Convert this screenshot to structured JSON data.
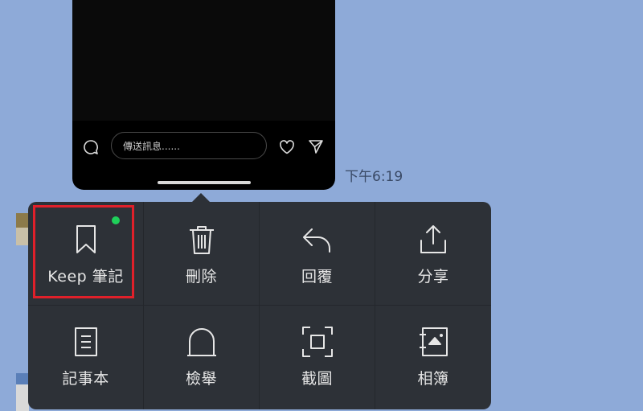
{
  "message_bar": {
    "input_placeholder": "傳送訊息......"
  },
  "timestamp": "下午6:19",
  "menu": {
    "items": [
      {
        "label": "Keep 筆記",
        "icon": "bookmark-icon"
      },
      {
        "label": "刪除",
        "icon": "trash-icon"
      },
      {
        "label": "回覆",
        "icon": "reply-icon"
      },
      {
        "label": "分享",
        "icon": "share-icon"
      },
      {
        "label": "記事本",
        "icon": "note-icon"
      },
      {
        "label": "檢舉",
        "icon": "report-icon"
      },
      {
        "label": "截圖",
        "icon": "screenshot-icon"
      },
      {
        "label": "相簿",
        "icon": "album-icon"
      }
    ]
  },
  "colors": {
    "background": "#8eaad8",
    "menu_bg": "#2d3137",
    "highlight": "#e0202a",
    "new_dot": "#1fd05a"
  }
}
